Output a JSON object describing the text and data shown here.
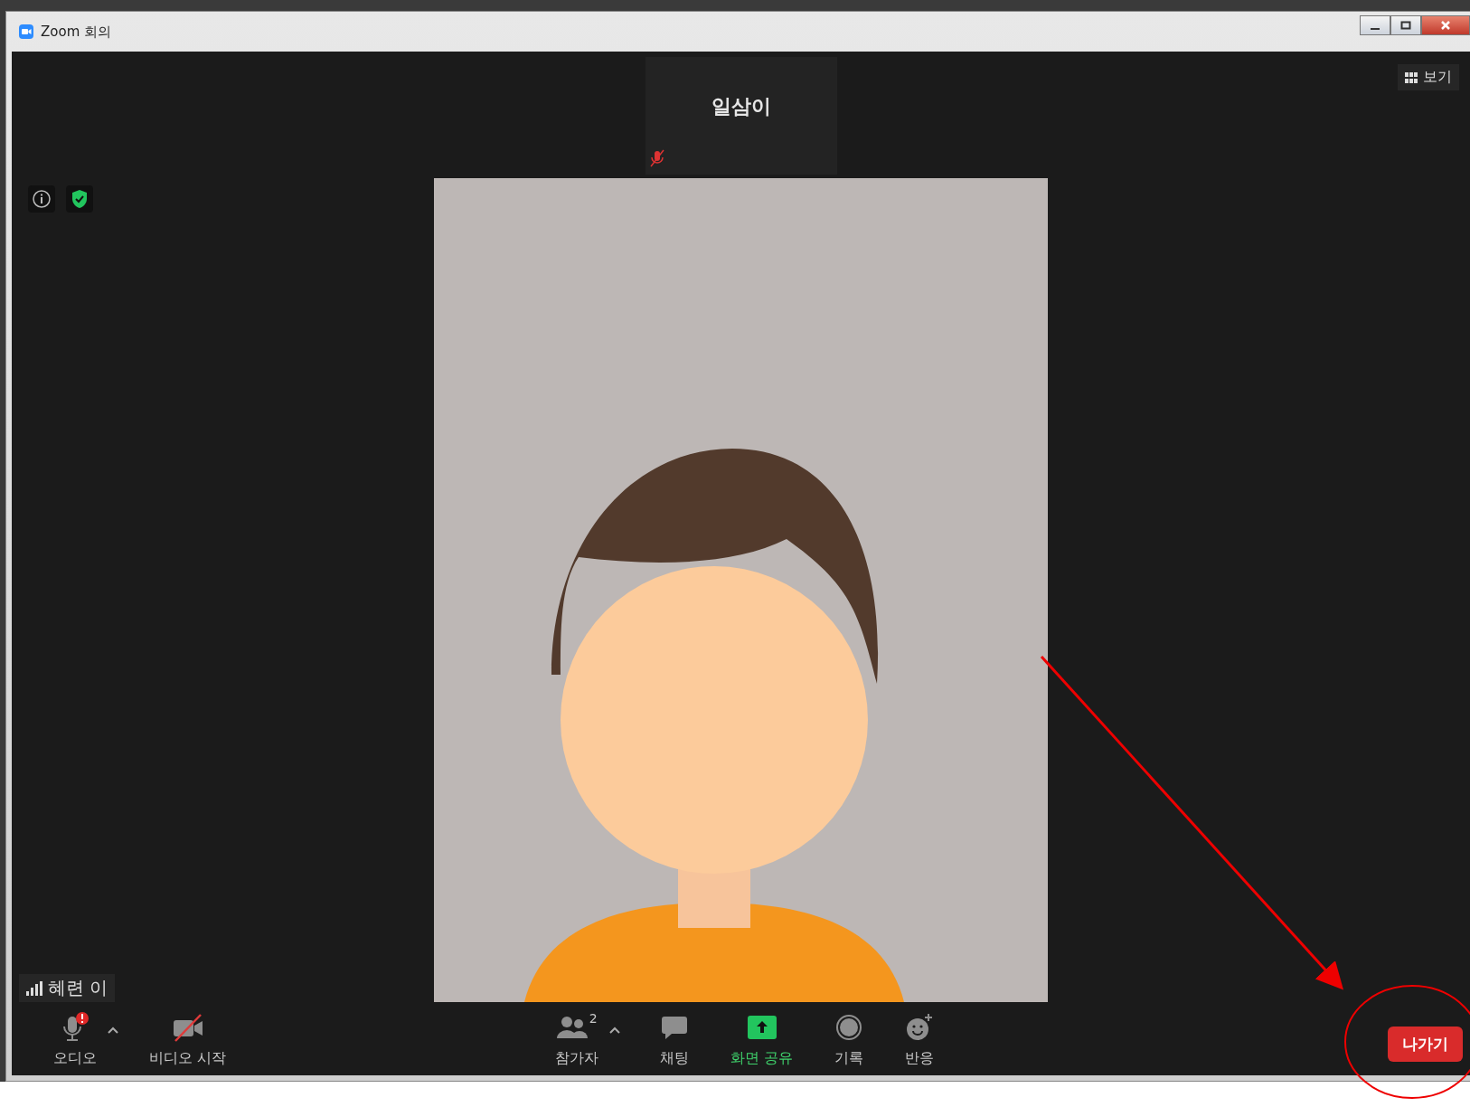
{
  "window": {
    "title": "Zoom 회의"
  },
  "view_button": "보기",
  "active_speaker": {
    "name": "일삼이",
    "muted": true
  },
  "self_label": "혜련 이",
  "toolbar_left": [
    {
      "kind": "audio",
      "label": "오디오"
    },
    {
      "kind": "video",
      "label": "비디오 시작"
    }
  ],
  "toolbar_center": [
    {
      "kind": "participants",
      "label": "참가자",
      "count": "2"
    },
    {
      "kind": "chat",
      "label": "채팅"
    },
    {
      "kind": "share",
      "label": "화면 공유"
    },
    {
      "kind": "record",
      "label": "기록"
    },
    {
      "kind": "reactions",
      "label": "반응"
    }
  ],
  "leave_button": "나가기"
}
